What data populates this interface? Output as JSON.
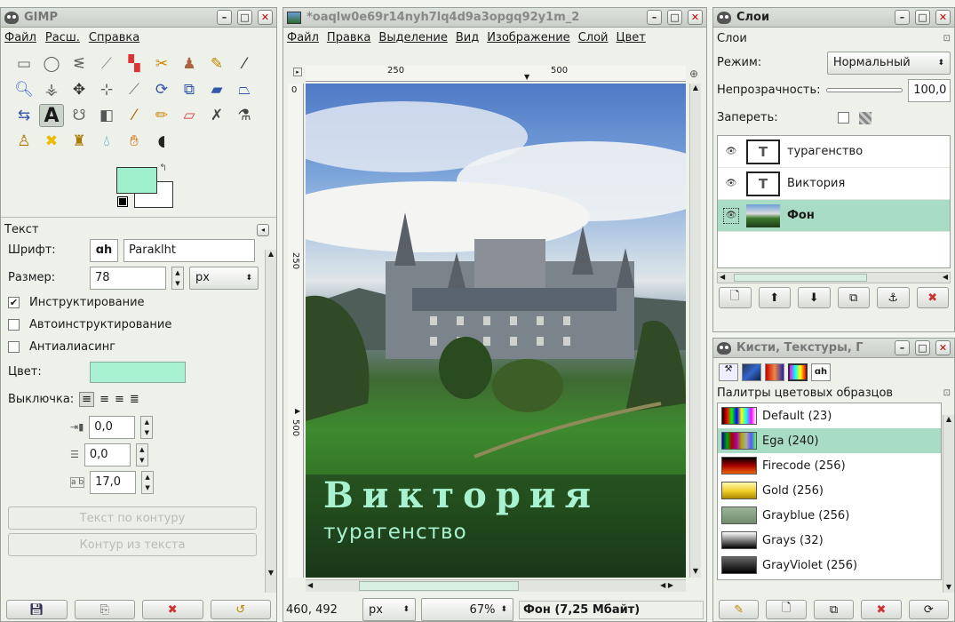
{
  "toolbox": {
    "title": "GIMP",
    "menu": [
      "Файл",
      "Расш.",
      "Справка"
    ],
    "tools": [
      "rect-select",
      "ellipse-select",
      "free-select",
      "fuzzy-select",
      "color-select",
      "scissors",
      "foreground-select",
      "paths",
      "color-picker",
      "zoom",
      "measure",
      "move",
      "align",
      "crop",
      "rotate",
      "scale",
      "shear",
      "perspective",
      "flip",
      "text",
      "cage",
      "bucket-fill",
      "blend",
      "pencil",
      "paintbrush",
      "eraser",
      "airbrush",
      "ink",
      "clone",
      "heal",
      "perspective-clone",
      "blur",
      "smudge",
      "dodge-burn"
    ],
    "fg_color": "#9ff0cc",
    "bg_color": "#ffffff",
    "options_title": "Текст",
    "font_label": "Шрифт:",
    "font_value": "Paraklht",
    "size_label": "Размер:",
    "size_value": "78",
    "size_unit": "px",
    "hinting_label": "Инструктирование",
    "hinting_checked": true,
    "autohint_label": "Автоинструктирование",
    "antialias_label": "Антиалиасинг",
    "color_label": "Цвет:",
    "color_value": "#a9f2d1",
    "justify_label": "Выключка:",
    "indent_value": "0,0",
    "line_spacing_value": "0,0",
    "letter_spacing_value": "17,0",
    "text_on_path_label": "Текст по контуру",
    "path_from_text_label": "Контур из текста"
  },
  "image": {
    "title": "*oaqlw0e69r14nyh7lq4d9a3opgq92y1m_2",
    "menu": [
      "Файл",
      "Правка",
      "Выделение",
      "Вид",
      "Изображение",
      "Слой",
      "Цвет"
    ],
    "ruler_marks": [
      "250",
      "500"
    ],
    "vruler_marks": [
      "250",
      "500"
    ],
    "text_main": "Виктория",
    "text_sub": "турагенство",
    "coords": "460, 492",
    "unit": "px",
    "zoom": "67%",
    "status": "Фон (7,25 Мбайт)"
  },
  "layers": {
    "title": "Слои",
    "tab": "Слои",
    "mode_label": "Режим:",
    "mode_value": "Нормальный",
    "opacity_label": "Непрозрачность:",
    "opacity_value": "100,0",
    "lock_label": "Запереть:",
    "items": [
      {
        "name": "турагенство",
        "type": "text"
      },
      {
        "name": "Виктория",
        "type": "text"
      },
      {
        "name": "Фон",
        "type": "image",
        "selected": true
      }
    ]
  },
  "brushes": {
    "title": "Кисти, Текстуры, Г",
    "list_title": "Палитры цветовых образцов",
    "palettes": [
      {
        "name": "Default (23)",
        "sel": false
      },
      {
        "name": "Ega (240)",
        "sel": true
      },
      {
        "name": "Firecode (256)",
        "sel": false
      },
      {
        "name": "Gold (256)",
        "sel": false
      },
      {
        "name": "Grayblue (256)",
        "sel": false
      },
      {
        "name": "Grays (32)",
        "sel": false
      },
      {
        "name": "GrayViolet (256)",
        "sel": false
      }
    ]
  }
}
